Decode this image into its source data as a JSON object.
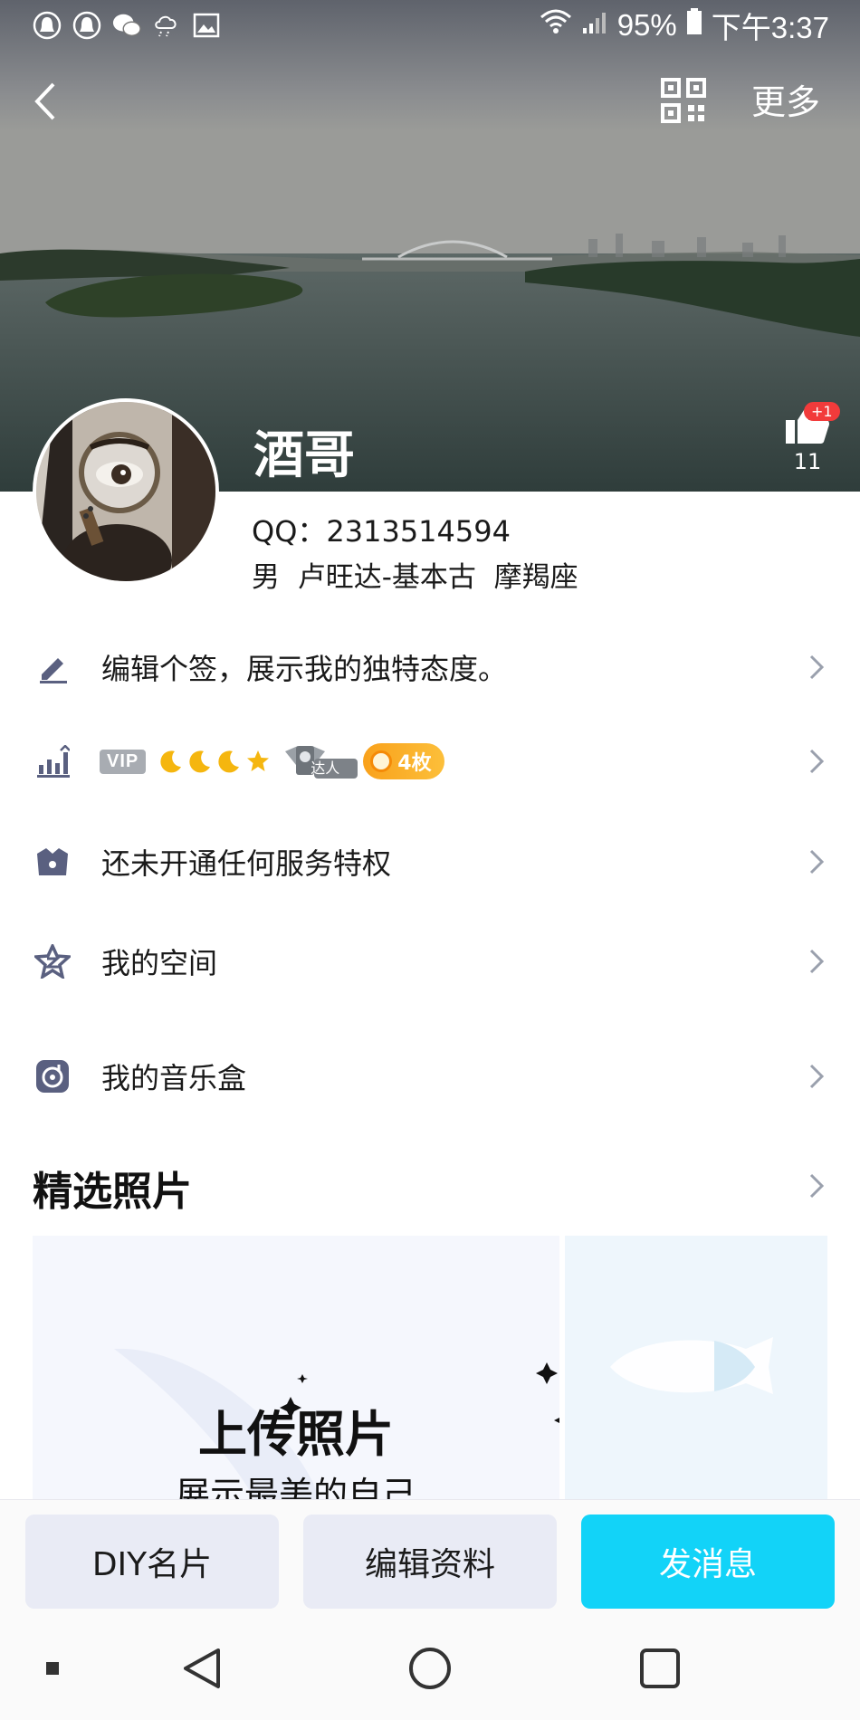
{
  "status_bar": {
    "battery": "95%",
    "time": "下午3:37",
    "left_icons": [
      "qq-notification-icon",
      "qq-notification-icon",
      "wechat-icon",
      "cloud-icon",
      "image-icon"
    ],
    "right_icons": [
      "wifi-icon",
      "signal-icon",
      "battery-icon"
    ]
  },
  "nav": {
    "back_icon": "chevron-left-icon",
    "qr_icon": "qr-code-icon",
    "more_label": "更多"
  },
  "profile": {
    "nickname": "酒哥",
    "likes_plus": "+1",
    "likes_count": "11",
    "qq": "QQ：2313514594",
    "info": "男  卢旺达-基本古  摩羯座"
  },
  "rows": {
    "signature": "编辑个签，展示我的独特态度。",
    "vip": {
      "badge": "VIP",
      "daren_label": "达人",
      "medals": "4枚"
    },
    "service": "还未开通任何服务特权",
    "space": "我的空间",
    "music": "我的音乐盒"
  },
  "photos": {
    "title": "精选照片",
    "upload_title": "上传照片",
    "upload_sub": "展示最美的自己"
  },
  "actions": {
    "diy": "DIY名片",
    "edit": "编辑资料",
    "message": "发消息"
  },
  "colors": {
    "accent": "#12d3f8",
    "gray_button": "#e9ebf5",
    "badge_red": "#f23b3b",
    "medal_orange": "#f9a11b"
  }
}
